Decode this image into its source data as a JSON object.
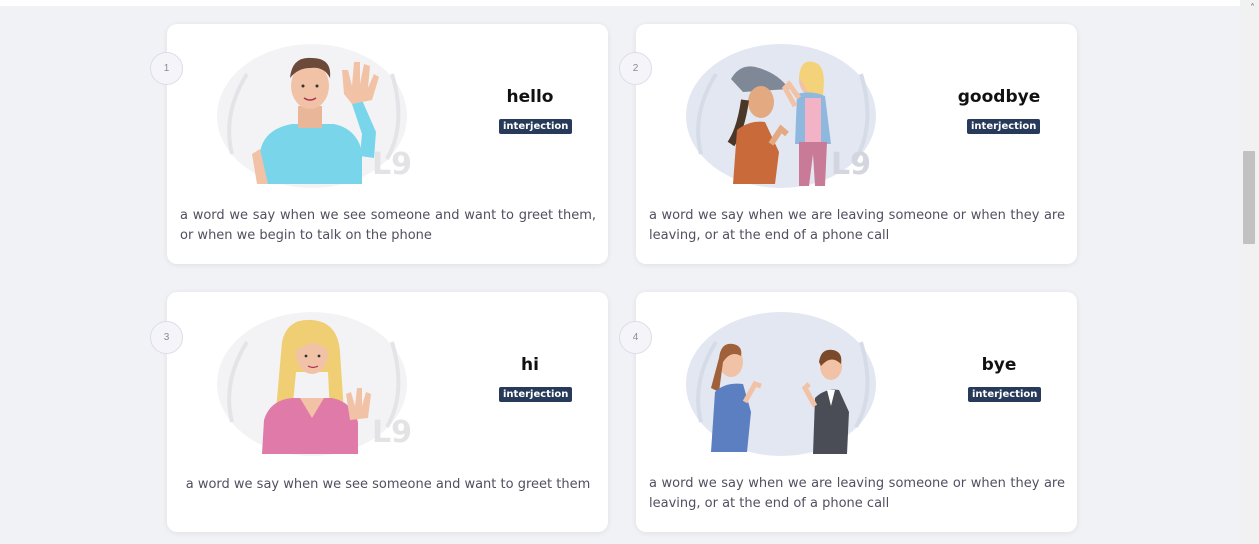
{
  "cards": [
    {
      "number": "1",
      "word": "hello",
      "part_of_speech": "interjection",
      "definition": "a word we say when we see someone and want to greet them, or when we begin to talk on the phone",
      "illustration": "man-waving-illustration"
    },
    {
      "number": "2",
      "word": "goodbye",
      "part_of_speech": "interjection",
      "definition": "a word we say when we are leaving someone or when they are leaving, or at the end of a phone call",
      "illustration": "two-women-parting-illustration"
    },
    {
      "number": "3",
      "word": "hi",
      "part_of_speech": "interjection",
      "definition": "a word we say when we see someone and want to greet them",
      "illustration": "woman-waving-illustration"
    },
    {
      "number": "4",
      "word": "bye",
      "part_of_speech": "interjection",
      "definition": "a word we say when we are leaving someone or when they are leaving, or at the end of a phone call",
      "illustration": "man-and-woman-waving-illustration"
    }
  ],
  "colors": {
    "page_bg": "#f1f2f6",
    "card_bg": "#ffffff",
    "badge_bg": "#273a59",
    "badge_text": "#ffffff",
    "definition_text": "#505060"
  },
  "icons": {
    "scroll_up": "chevron-up-icon"
  }
}
